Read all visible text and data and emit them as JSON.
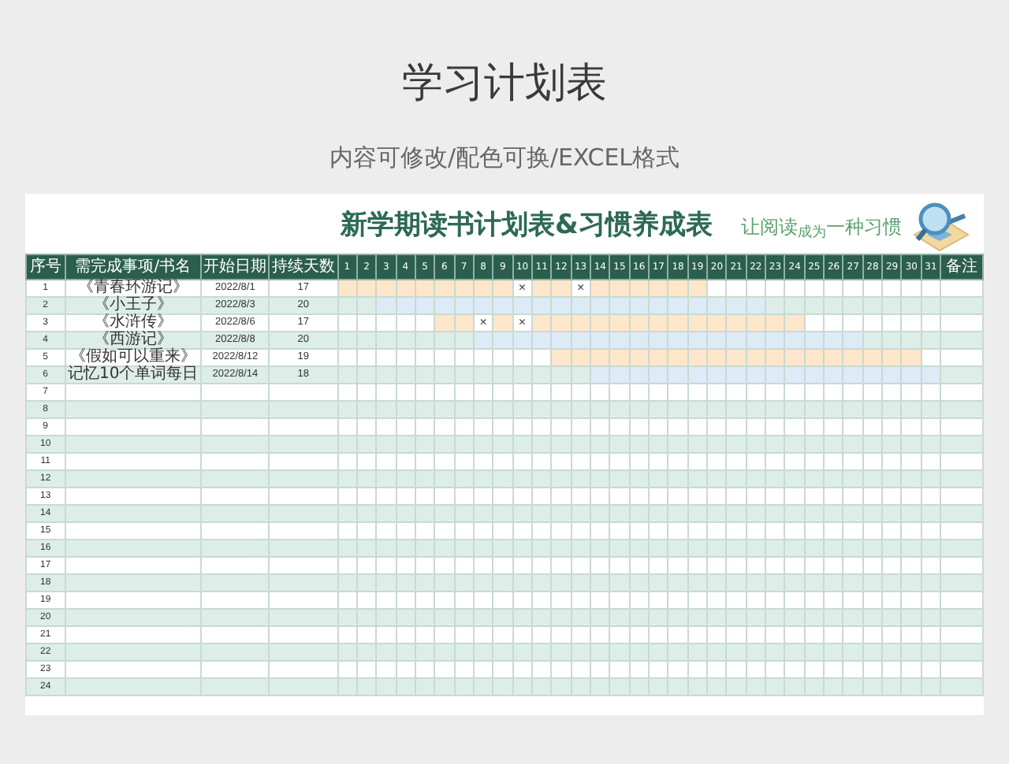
{
  "page_title": "学习计划表",
  "subtitle": "内容可修改/配色可换/EXCEL格式",
  "sheet": {
    "title": "新学期读书计划表&习惯养成表",
    "tagline": "让阅读$_{成为}$一种习惯",
    "columns": [
      "序号",
      "需完成事项/书名",
      "开始日期",
      "持续天数",
      "1",
      "2",
      "3",
      "4",
      "5",
      "6",
      "7",
      "8",
      "9",
      "10",
      "11",
      "12",
      "13",
      "14",
      "15",
      "16",
      "17",
      "18",
      "19",
      "20",
      "21",
      "22",
      "23",
      "24",
      "25",
      "26",
      "27",
      "28",
      "29",
      "30",
      "31",
      "备注"
    ],
    "rows": [
      {
        "no": "1",
        "item": "《青春环游记》",
        "start": "2022/8/1",
        "days_count": "17",
        "color": "#fde6c9",
        "days": [
          {
            "kind": "plan"
          },
          {
            "kind": "plan"
          },
          {
            "kind": "plan"
          },
          {
            "kind": "plan"
          },
          {
            "kind": "plan"
          },
          {
            "kind": "plan"
          },
          {
            "kind": "plan"
          },
          {
            "kind": "plan"
          },
          {
            "kind": "plan"
          },
          {
            "kind": "mark",
            "text": "×"
          },
          {
            "kind": "plan"
          },
          {
            "kind": "plan"
          },
          {
            "kind": "mark",
            "text": "×"
          },
          {
            "kind": "plan"
          },
          {
            "kind": "plan"
          },
          {
            "kind": "plan"
          },
          {
            "kind": "plan"
          },
          {
            "kind": "plan"
          },
          {
            "kind": "plan"
          },
          {
            "kind": "none"
          },
          {
            "kind": "none"
          },
          {
            "kind": "none"
          },
          {
            "kind": "none"
          },
          {
            "kind": "none"
          },
          {
            "kind": "none"
          },
          {
            "kind": "none"
          },
          {
            "kind": "none"
          },
          {
            "kind": "none"
          },
          {
            "kind": "none"
          },
          {
            "kind": "none"
          },
          {
            "kind": "none"
          }
        ]
      },
      {
        "no": "2",
        "item": "《小王子》",
        "start": "2022/8/3",
        "days_count": "20",
        "color": "#dcebf5",
        "days": [
          {
            "kind": "none"
          },
          {
            "kind": "none"
          },
          {
            "kind": "plan"
          },
          {
            "kind": "plan"
          },
          {
            "kind": "plan"
          },
          {
            "kind": "plan"
          },
          {
            "kind": "plan"
          },
          {
            "kind": "plan"
          },
          {
            "kind": "plan"
          },
          {
            "kind": "plan"
          },
          {
            "kind": "plan"
          },
          {
            "kind": "plan"
          },
          {
            "kind": "plan"
          },
          {
            "kind": "plan"
          },
          {
            "kind": "plan"
          },
          {
            "kind": "plan"
          },
          {
            "kind": "plan"
          },
          {
            "kind": "plan"
          },
          {
            "kind": "plan"
          },
          {
            "kind": "plan"
          },
          {
            "kind": "plan"
          },
          {
            "kind": "plan"
          },
          {
            "kind": "none"
          },
          {
            "kind": "none"
          },
          {
            "kind": "none"
          },
          {
            "kind": "none"
          },
          {
            "kind": "none"
          },
          {
            "kind": "none"
          },
          {
            "kind": "none"
          },
          {
            "kind": "none"
          },
          {
            "kind": "none"
          }
        ]
      },
      {
        "no": "3",
        "item": "《水浒传》",
        "start": "2022/8/6",
        "days_count": "17",
        "color": "#fde6c9",
        "days": [
          {
            "kind": "none"
          },
          {
            "kind": "none"
          },
          {
            "kind": "none"
          },
          {
            "kind": "none"
          },
          {
            "kind": "none"
          },
          {
            "kind": "plan"
          },
          {
            "kind": "plan"
          },
          {
            "kind": "mark",
            "text": "×"
          },
          {
            "kind": "plan"
          },
          {
            "kind": "mark",
            "text": "×"
          },
          {
            "kind": "plan"
          },
          {
            "kind": "plan"
          },
          {
            "kind": "plan"
          },
          {
            "kind": "plan"
          },
          {
            "kind": "plan"
          },
          {
            "kind": "plan"
          },
          {
            "kind": "plan"
          },
          {
            "kind": "plan"
          },
          {
            "kind": "plan"
          },
          {
            "kind": "plan"
          },
          {
            "kind": "plan"
          },
          {
            "kind": "plan"
          },
          {
            "kind": "plan"
          },
          {
            "kind": "plan"
          },
          {
            "kind": "none"
          },
          {
            "kind": "none"
          },
          {
            "kind": "none"
          },
          {
            "kind": "none"
          },
          {
            "kind": "none"
          },
          {
            "kind": "none"
          },
          {
            "kind": "none"
          }
        ]
      },
      {
        "no": "4",
        "item": "《西游记》",
        "start": "2022/8/8",
        "days_count": "20",
        "color": "#dcebf5",
        "days": [
          {
            "kind": "none"
          },
          {
            "kind": "none"
          },
          {
            "kind": "none"
          },
          {
            "kind": "none"
          },
          {
            "kind": "none"
          },
          {
            "kind": "none"
          },
          {
            "kind": "none"
          },
          {
            "kind": "plan"
          },
          {
            "kind": "plan"
          },
          {
            "kind": "plan"
          },
          {
            "kind": "plan"
          },
          {
            "kind": "plan"
          },
          {
            "kind": "plan"
          },
          {
            "kind": "plan"
          },
          {
            "kind": "plan"
          },
          {
            "kind": "plan"
          },
          {
            "kind": "plan"
          },
          {
            "kind": "plan"
          },
          {
            "kind": "plan"
          },
          {
            "kind": "plan"
          },
          {
            "kind": "plan"
          },
          {
            "kind": "plan"
          },
          {
            "kind": "plan"
          },
          {
            "kind": "plan"
          },
          {
            "kind": "plan"
          },
          {
            "kind": "plan"
          },
          {
            "kind": "plan"
          },
          {
            "kind": "none"
          },
          {
            "kind": "none"
          },
          {
            "kind": "none"
          },
          {
            "kind": "none"
          }
        ]
      },
      {
        "no": "5",
        "item": "《假如可以重来》",
        "start": "2022/8/12",
        "days_count": "19",
        "color": "#fde6c9",
        "days": [
          {
            "kind": "none"
          },
          {
            "kind": "none"
          },
          {
            "kind": "none"
          },
          {
            "kind": "none"
          },
          {
            "kind": "none"
          },
          {
            "kind": "none"
          },
          {
            "kind": "none"
          },
          {
            "kind": "none"
          },
          {
            "kind": "none"
          },
          {
            "kind": "none"
          },
          {
            "kind": "none"
          },
          {
            "kind": "plan"
          },
          {
            "kind": "plan"
          },
          {
            "kind": "plan"
          },
          {
            "kind": "plan"
          },
          {
            "kind": "plan"
          },
          {
            "kind": "plan"
          },
          {
            "kind": "plan"
          },
          {
            "kind": "plan"
          },
          {
            "kind": "plan"
          },
          {
            "kind": "plan"
          },
          {
            "kind": "plan"
          },
          {
            "kind": "plan"
          },
          {
            "kind": "plan"
          },
          {
            "kind": "plan"
          },
          {
            "kind": "plan"
          },
          {
            "kind": "plan"
          },
          {
            "kind": "plan"
          },
          {
            "kind": "plan"
          },
          {
            "kind": "plan"
          },
          {
            "kind": "none"
          }
        ]
      },
      {
        "no": "6",
        "item": "记忆10个单词每日",
        "start": "2022/8/14",
        "days_count": "18",
        "color": "#dcebf5",
        "days": [
          {
            "kind": "none"
          },
          {
            "kind": "none"
          },
          {
            "kind": "none"
          },
          {
            "kind": "none"
          },
          {
            "kind": "none"
          },
          {
            "kind": "none"
          },
          {
            "kind": "none"
          },
          {
            "kind": "none"
          },
          {
            "kind": "none"
          },
          {
            "kind": "none"
          },
          {
            "kind": "none"
          },
          {
            "kind": "none"
          },
          {
            "kind": "none"
          },
          {
            "kind": "plan"
          },
          {
            "kind": "plan"
          },
          {
            "kind": "plan"
          },
          {
            "kind": "plan"
          },
          {
            "kind": "plan"
          },
          {
            "kind": "plan"
          },
          {
            "kind": "plan"
          },
          {
            "kind": "plan"
          },
          {
            "kind": "plan"
          },
          {
            "kind": "plan"
          },
          {
            "kind": "plan"
          },
          {
            "kind": "plan"
          },
          {
            "kind": "plan"
          },
          {
            "kind": "plan"
          },
          {
            "kind": "plan"
          },
          {
            "kind": "plan"
          },
          {
            "kind": "plan"
          },
          {
            "kind": "plan"
          }
        ]
      },
      {
        "no": "7"
      },
      {
        "no": "8"
      },
      {
        "no": "9"
      },
      {
        "no": "10"
      },
      {
        "no": "11"
      },
      {
        "no": "12"
      },
      {
        "no": "13"
      },
      {
        "no": "14"
      },
      {
        "no": "15"
      },
      {
        "no": "16"
      },
      {
        "no": "17"
      },
      {
        "no": "18"
      },
      {
        "no": "19"
      },
      {
        "no": "20"
      },
      {
        "no": "21"
      },
      {
        "no": "22"
      },
      {
        "no": "23"
      },
      {
        "no": "24"
      }
    ]
  }
}
